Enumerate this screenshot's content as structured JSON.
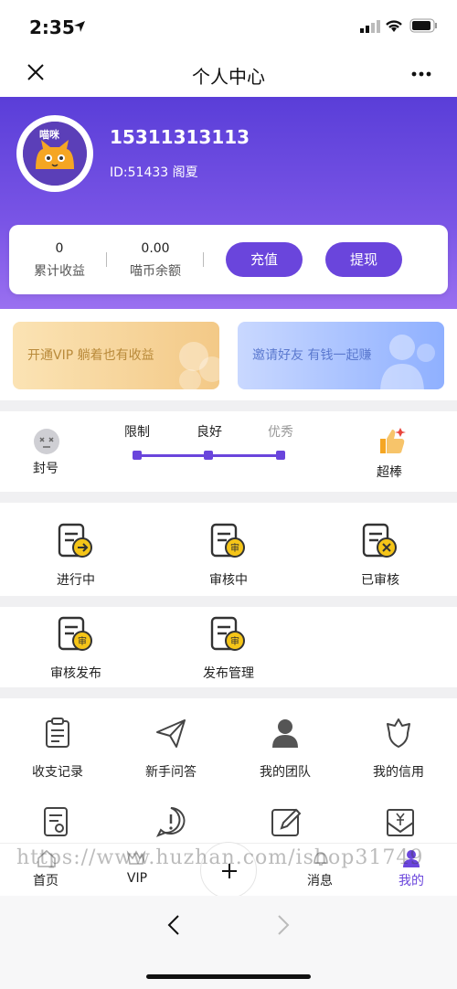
{
  "status": {
    "time": "2:35"
  },
  "nav": {
    "title": "个人中心"
  },
  "profile": {
    "phone": "15311313113",
    "id_line": "ID:51433 阁夏",
    "avatar_text": "喵咪"
  },
  "wallet": {
    "earnings_value": "0",
    "earnings_label": "累计收益",
    "balance_value": "0.00",
    "balance_label": "喵币余额",
    "recharge_label": "充值",
    "withdraw_label": "提现"
  },
  "banners": {
    "vip": "开通VIP 躺着也有收益",
    "invite": "邀请好友 有钱一起赚"
  },
  "credit": {
    "left_label": "封号",
    "right_label": "超棒",
    "levels": [
      "限制",
      "良好",
      "优秀"
    ]
  },
  "tasks": [
    {
      "label": "进行中"
    },
    {
      "label": "审核中"
    },
    {
      "label": "已审核"
    }
  ],
  "publish": [
    {
      "label": "审核发布"
    },
    {
      "label": "发布管理"
    }
  ],
  "tools": [
    {
      "label": "收支记录"
    },
    {
      "label": "新手问答"
    },
    {
      "label": "我的团队"
    },
    {
      "label": "我的信用"
    }
  ],
  "stamp_text": "审",
  "tabs": [
    {
      "label": "首页"
    },
    {
      "label": "VIP"
    },
    {
      "label": "消息"
    },
    {
      "label": "我的"
    }
  ],
  "watermark": "https://www.huzhan.com/ishop31749",
  "colors": {
    "primary": "#6a45dc",
    "header_top": "#5a3ed8",
    "header_bottom": "#9a70f0",
    "stamp": "#f5c518"
  }
}
